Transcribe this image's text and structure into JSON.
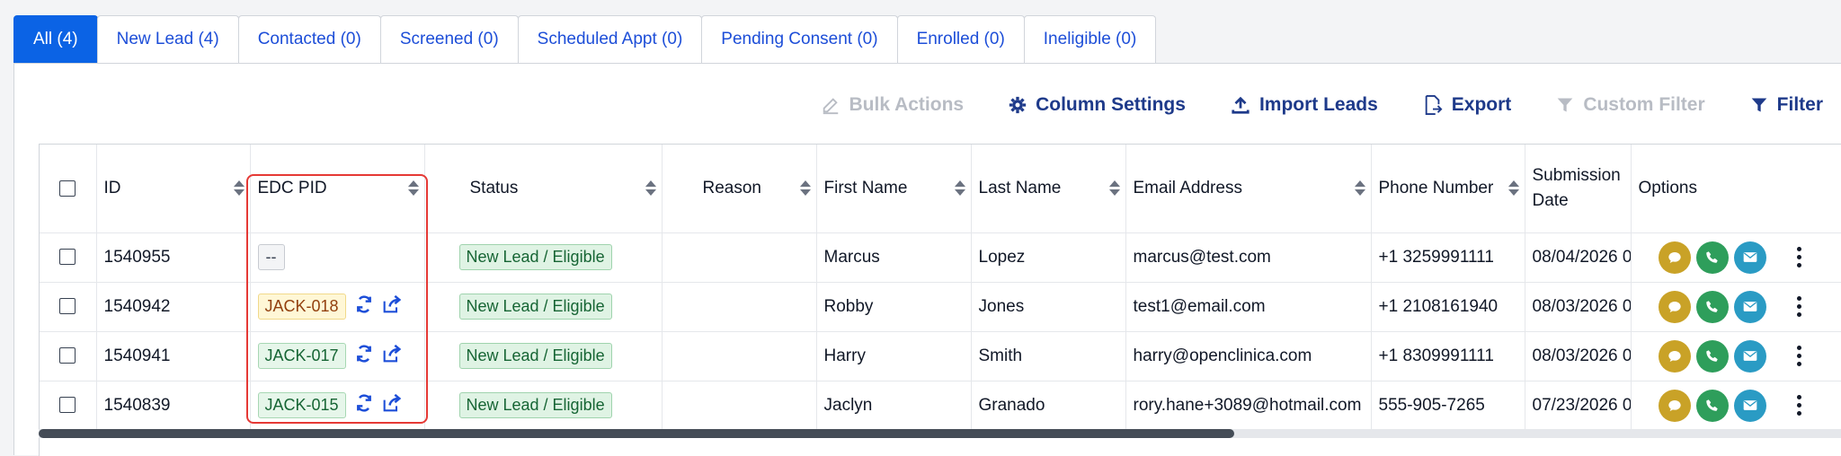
{
  "tabs": [
    {
      "label": "All (4)",
      "active": true
    },
    {
      "label": "New Lead (4)"
    },
    {
      "label": "Contacted (0)"
    },
    {
      "label": "Screened (0)"
    },
    {
      "label": "Scheduled Appt (0)"
    },
    {
      "label": "Pending Consent (0)"
    },
    {
      "label": "Enrolled (0)"
    },
    {
      "label": "Ineligible (0)"
    }
  ],
  "toolbar": {
    "bulk_actions": "Bulk Actions",
    "column_settings": "Column Settings",
    "import_leads": "Import Leads",
    "export": "Export",
    "custom_filter": "Custom Filter",
    "filter": "Filter"
  },
  "columns": [
    "ID",
    "EDC PID",
    "Status",
    "Reason",
    "First Name",
    "Last Name",
    "Email Address",
    "Phone Number",
    "Submission Date",
    "Options"
  ],
  "rows": [
    {
      "id": "1540955",
      "pid": "--",
      "pid_style": "empty",
      "status": "New Lead / Eligible",
      "reason": "",
      "first": "Marcus",
      "last": "Lopez",
      "email": "marcus@test.com",
      "phone": "+1 3259991111",
      "date": "08/04/2026 0"
    },
    {
      "id": "1540942",
      "pid": "JACK-018",
      "pid_style": "yellow",
      "status": "New Lead / Eligible",
      "reason": "",
      "first": "Robby",
      "last": "Jones",
      "email": "test1@email.com",
      "phone": "+1 2108161940",
      "date": "08/03/2026 0"
    },
    {
      "id": "1540941",
      "pid": "JACK-017",
      "pid_style": "green",
      "status": "New Lead / Eligible",
      "reason": "",
      "first": "Harry",
      "last": "Smith",
      "email": "harry@openclinica.com",
      "phone": "+1 8309991111",
      "date": "08/03/2026 0"
    },
    {
      "id": "1540839",
      "pid": "JACK-015",
      "pid_style": "green",
      "status": "New Lead / Eligible",
      "reason": "",
      "first": "Jaclyn",
      "last": "Granado",
      "email": "rory.hane+3089@hotmail.com",
      "phone": "555-905-7265",
      "date": "07/23/2026 0"
    }
  ],
  "colors": {
    "accent": "#0b63e5",
    "link": "#1e3a8a",
    "highlight": "#e53935",
    "chat": "#c9a227",
    "phone": "#2e9e5b",
    "mail": "#2a9bc4"
  },
  "icons": [
    "pencil-icon",
    "gear-icon",
    "upload-icon",
    "export-icon",
    "funnel-icon",
    "sync-icon",
    "share-icon",
    "chat-icon",
    "phone-icon",
    "mail-icon",
    "kebab-icon",
    "sort-icon"
  ]
}
